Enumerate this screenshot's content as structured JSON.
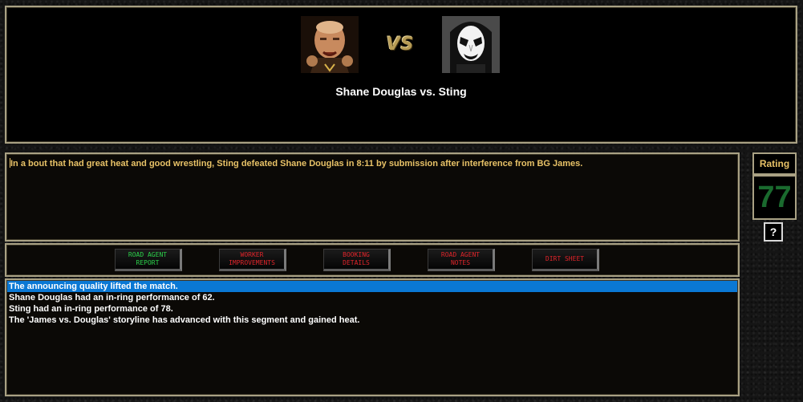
{
  "match": {
    "wrestler1": "Shane Douglas",
    "wrestler2": "Sting",
    "vs_label": "VS",
    "title": "Shane Douglas vs. Sting"
  },
  "description": "In a bout that had great heat and good wrestling, Sting defeated Shane Douglas in 8:11 by submission after interference from BG James.",
  "rating": {
    "label": "Rating",
    "value": "77",
    "help_label": "?"
  },
  "buttons": [
    {
      "label": "ROAD AGENT\nREPORT",
      "color": "#2bd14a"
    },
    {
      "label": "WORKER\nIMPROVEMENTS",
      "color": "#e0242a"
    },
    {
      "label": "BOOKING\nDETAILS",
      "color": "#e0242a"
    },
    {
      "label": "ROAD AGENT\nNOTES",
      "color": "#e0242a"
    },
    {
      "label": "DIRT SHEET",
      "color": "#e0242a"
    }
  ],
  "log": [
    {
      "text": "The announcing quality lifted the match.",
      "selected": true
    },
    {
      "text": "Shane Douglas had an in-ring performance of 62.",
      "selected": false
    },
    {
      "text": "Sting had an in-ring performance of 78.",
      "selected": false
    },
    {
      "text": "The 'James vs. Douglas' storyline has advanced with this segment and gained heat.",
      "selected": false
    }
  ]
}
